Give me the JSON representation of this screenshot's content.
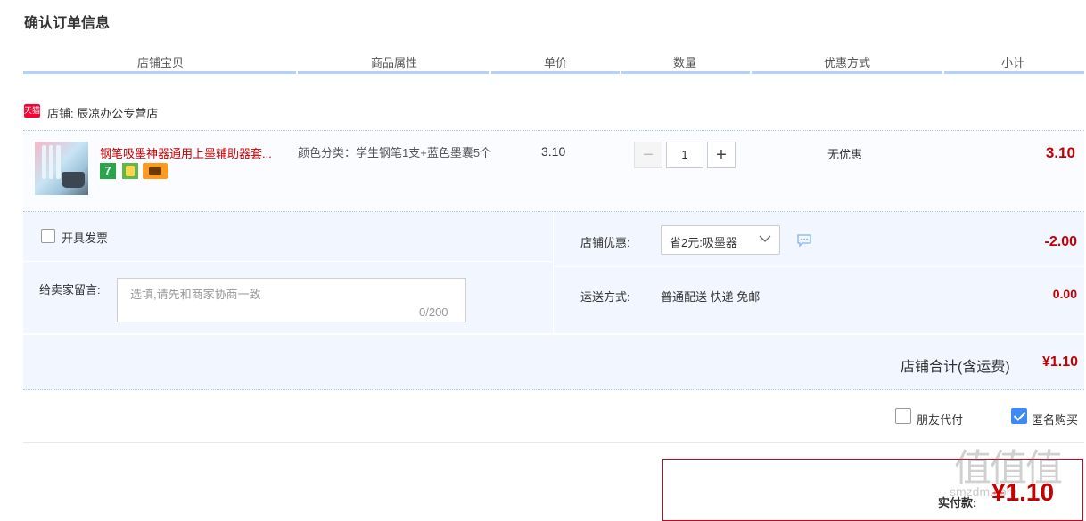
{
  "page": {
    "title": "确认订单信息"
  },
  "table_header": {
    "columns": [
      "店铺宝贝",
      "商品属性",
      "单价",
      "数量",
      "优惠方式",
      "小计"
    ]
  },
  "shop": {
    "badge": "天猫",
    "label": "店铺: 辰凉办公专营店"
  },
  "item": {
    "title": "钢笔吸墨神器通用上墨辅助器套...",
    "badge_seven": "7",
    "attribute": "颜色分类：学生钢笔1支+蓝色墨囊5个",
    "price": "3.10",
    "quantity": "1",
    "minus": "−",
    "plus": "+",
    "discount": "无优惠",
    "subtotal": "3.10"
  },
  "options": {
    "invoice_label": "开具发票",
    "message_label": "给卖家留言:",
    "message_placeholder": "选填,请先和商家协商一致",
    "message_counter": "0/200",
    "shop_discount_label": "店铺优惠:",
    "shop_discount_selected": "省2元:吸墨器",
    "shop_discount_amount": "-2.00",
    "shipping_label": "运送方式:",
    "shipping_value": "普通配送 快递 免邮",
    "shipping_amount": "0.00"
  },
  "shop_total": {
    "label": "店铺合计(含运费)",
    "amount": "¥1.10"
  },
  "checkout": {
    "friend_pay_label": "朋友代付",
    "anonymous_label": "匿名购买",
    "anonymous_checked": true,
    "pay_label": "实付款:",
    "pay_amount": "¥1.10"
  },
  "watermark": {
    "main": "值值值",
    "sub": "smzdm.com"
  },
  "colors": {
    "accent_red": "#c40000",
    "header_line": "#b2d1ff",
    "panel_bg": "#f2f7ff",
    "check_blue": "#3d8af7"
  }
}
